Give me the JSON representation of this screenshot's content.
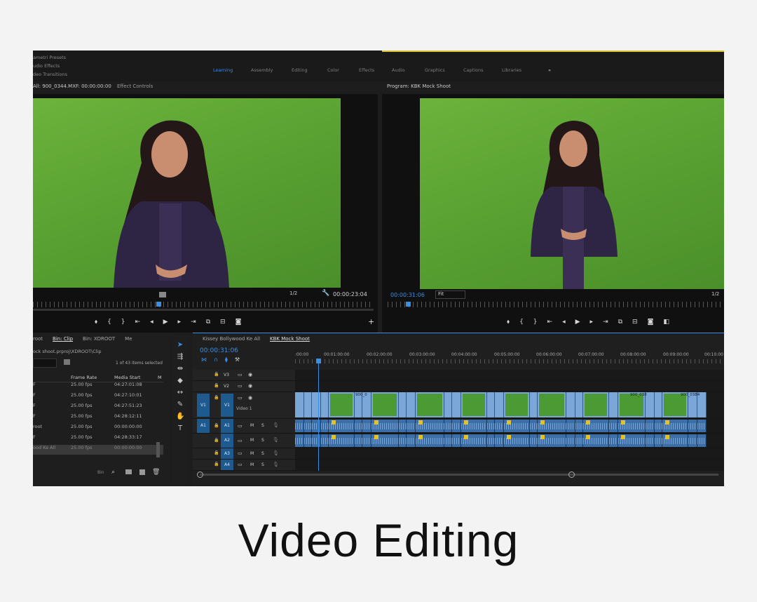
{
  "caption": "Video Editing",
  "workspace": {
    "essentials": [
      "ametri Presets",
      "udio Effects",
      "deo Transitions"
    ],
    "tabs": [
      "Learning",
      "Assembly",
      "Editing",
      "Color",
      "Effects",
      "Audio",
      "Graphics",
      "Captions",
      "Libraries",
      "»"
    ],
    "active_tab": "Learning"
  },
  "source_monitor": {
    "tab_label": "All: 900_0344.MXF: 00:00:00:00",
    "tab2_label": "Effect Controls",
    "zoom": "1/2",
    "timecode": "00:00:23:04"
  },
  "program_monitor": {
    "tab_label": "Program: KBK Mock Shoot",
    "timecode": "00:00:31:06",
    "fit": "Fit",
    "zoom": "1/2"
  },
  "project": {
    "tabs": [
      "root",
      "Bin: Clip",
      "Bin: XDROOT",
      "Me"
    ],
    "path": "ock shoot.prproj\\XDROOT\\Clip",
    "items_selected": "1 of 43 items selected",
    "columns": [
      "Frame Rate",
      "Media Start",
      "M"
    ],
    "rows": [
      {
        "name": "F",
        "fps": "25.00 fps",
        "start": "04:27:01:08"
      },
      {
        "name": "F",
        "fps": "25.00 fps",
        "start": "04:27:10:01"
      },
      {
        "name": "F",
        "fps": "25.00 fps",
        "start": "04:27:51:23"
      },
      {
        "name": "F",
        "fps": "25.00 fps",
        "start": "04:28:12:11"
      },
      {
        "name": "root",
        "fps": "25.00 fps",
        "start": "00:00:00:00"
      },
      {
        "name": "F",
        "fps": "25.00 fps",
        "start": "04:28:33:17"
      },
      {
        "name": "ood Ke All",
        "fps": "25.00 fps",
        "start": "00:00:00:00"
      }
    ],
    "footer_bin": "Bin"
  },
  "timeline": {
    "tabs": [
      "Kissey Bollywood Ke All",
      "KBK Mock Shoot"
    ],
    "active_tab": "KBK Mock Shoot",
    "timecode": "00:00:31:06",
    "ruler": [
      ":00:00",
      "00:01:00:00",
      "00:02:00:00",
      "00:03:00:00",
      "00:04:00:00",
      "00:05:00:00",
      "00:06:00:00",
      "00:07:00:00",
      "00:08:00:00",
      "00:09:00:00",
      "00:10:00"
    ],
    "video_tracks": [
      "V3",
      "V2",
      "V1"
    ],
    "video1_name": "Video 1",
    "audio_tracks": [
      "A1",
      "A2",
      "A3",
      "A4"
    ],
    "clip_labels": [
      "900_0",
      "900_038",
      "900_0384"
    ],
    "mute": "M",
    "solo": "S"
  },
  "colors": {
    "accent": "#3a8ee6",
    "green_screen": "#5aa232",
    "clip_video": "#7aa6d8",
    "clip_audio": "#3c6ea8"
  }
}
